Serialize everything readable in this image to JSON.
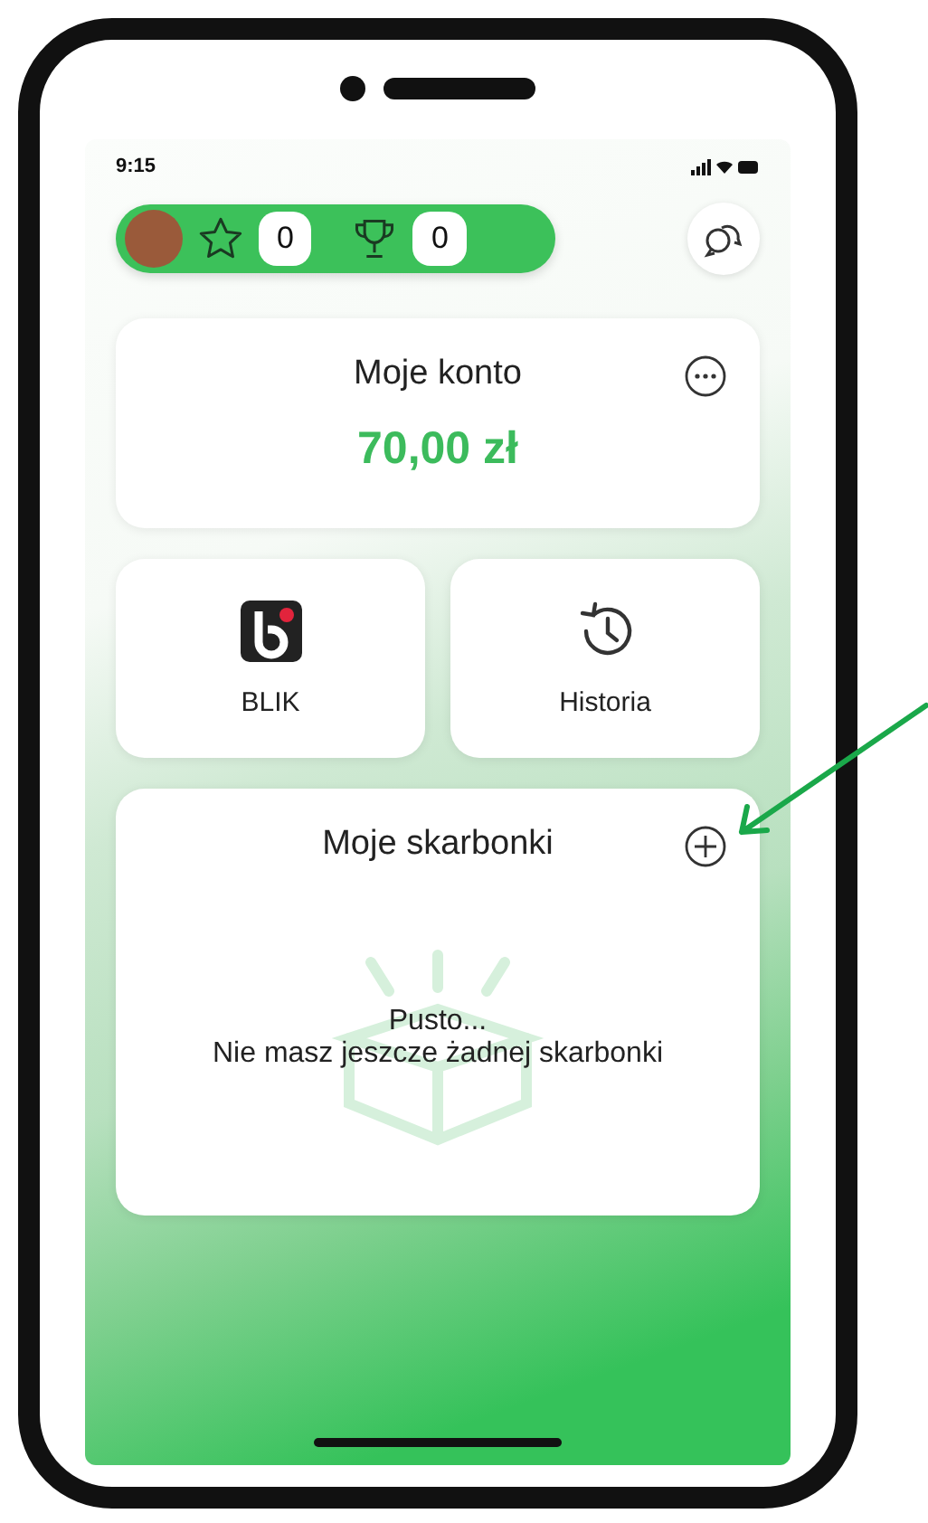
{
  "status_bar": {
    "time": "9:15"
  },
  "header": {
    "star_count": "0",
    "trophy_count": "0"
  },
  "account": {
    "title": "Moje konto",
    "balance": "70,00 zł"
  },
  "shortcuts": [
    {
      "label": "BLIK",
      "kind": "blik"
    },
    {
      "label": "Historia",
      "kind": "history"
    }
  ],
  "piggy_banks": {
    "title": "Moje skarbonki",
    "empty_title": "Pusto...",
    "empty_message": "Nie masz jeszcze żadnej skarbonki"
  }
}
